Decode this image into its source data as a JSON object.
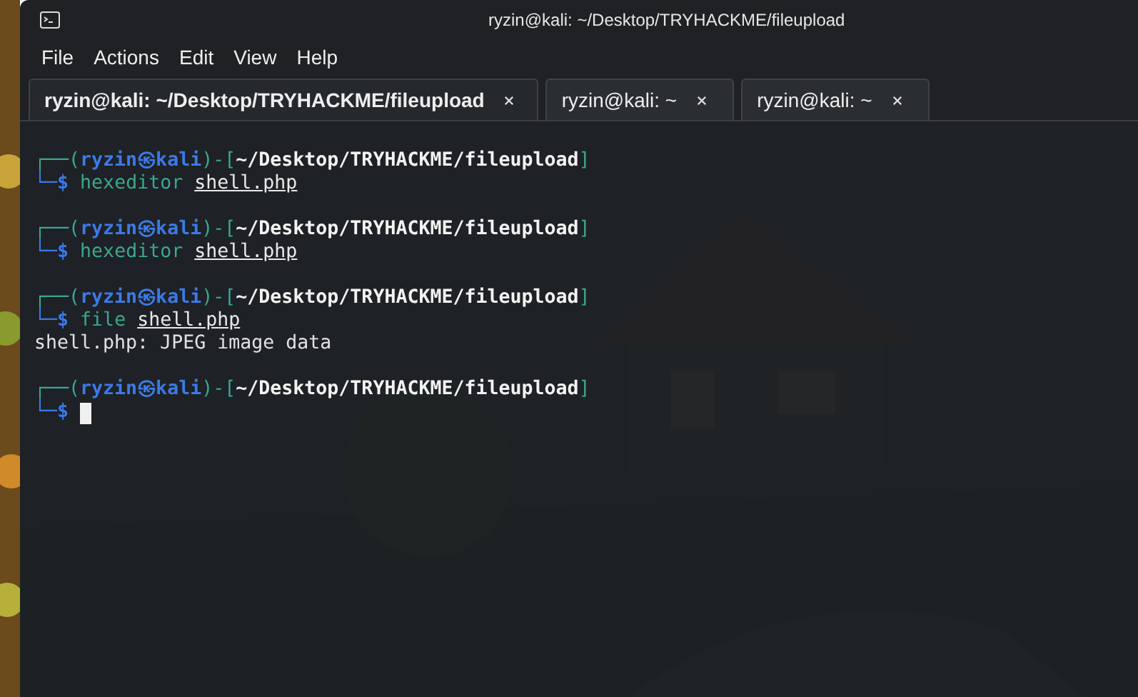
{
  "window": {
    "title": "ryzin@kali: ~/Desktop/TRYHACKME/fileupload"
  },
  "menu": [
    "File",
    "Actions",
    "Edit",
    "View",
    "Help"
  ],
  "tabs": [
    {
      "label": "ryzin@kali: ~/Desktop/TRYHACKME/fileupload",
      "selected": true
    },
    {
      "label": "ryzin@kali: ~",
      "selected": false
    },
    {
      "label": "ryzin@kali: ~",
      "selected": false
    }
  ],
  "terminal": {
    "blocks": [
      {
        "open": "┌──(",
        "user": "ryzin㉿kali",
        "mid": ")-[",
        "path": "~/Desktop/TRYHACKME/fileupload",
        "close": "]",
        "dollar": "└─$",
        "command": "hexeditor",
        "argument": "shell.php"
      },
      {
        "open": "┌──(",
        "user": "ryzin㉿kali",
        "mid": ")-[",
        "path": "~/Desktop/TRYHACKME/fileupload",
        "close": "]",
        "dollar": "└─$",
        "command": "hexeditor",
        "argument": "shell.php"
      },
      {
        "open": "┌──(",
        "user": "ryzin㉿kali",
        "mid": ")-[",
        "path": "~/Desktop/TRYHACKME/fileupload",
        "close": "]",
        "dollar": "└─$",
        "command": "file",
        "argument": "shell.php",
        "output": [
          "shell.php: JPEG image data"
        ]
      },
      {
        "open": "┌──(",
        "user": "ryzin㉿kali",
        "mid": ")-[",
        "path": "~/Desktop/TRYHACKME/fileupload",
        "close": "]",
        "dollar": "└─$",
        "cursor": true
      }
    ]
  }
}
